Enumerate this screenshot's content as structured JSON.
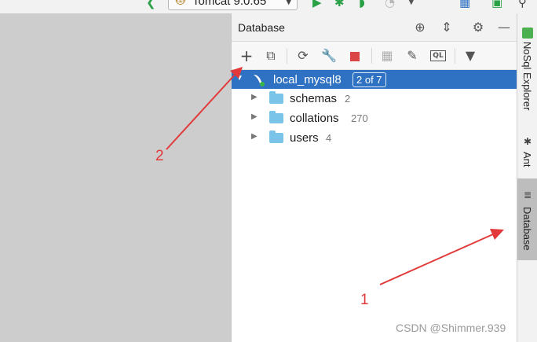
{
  "top_toolbar": {
    "run_config_label": "Tomcat 9.0.65",
    "icons": [
      "back-icon",
      "run-icon",
      "debug-icon",
      "coverage-icon",
      "profile-icon",
      "build-icon",
      "run-window-icon"
    ]
  },
  "database_panel": {
    "title": "Database",
    "header_icons": [
      "crosshair-icon",
      "collapse-icon",
      "gear-icon",
      "minimize-icon"
    ],
    "toolbar_icons": [
      "add-icon",
      "copy-icon",
      "refresh-icon",
      "properties-icon",
      "stop-icon",
      "table-icon",
      "edit-icon",
      "console-icon",
      "filter-icon"
    ],
    "tree": {
      "root": {
        "name": "local_mysql8",
        "badge": "2 of 7",
        "selected": true,
        "expanded": true
      },
      "children": [
        {
          "name": "schemas",
          "count": "2"
        },
        {
          "name": "collations",
          "count": "270"
        },
        {
          "name": "users",
          "count": "4"
        }
      ]
    }
  },
  "right_sidebar": {
    "tabs": [
      {
        "label": "NoSql Explorer",
        "icon": "nosql-icon",
        "active": false
      },
      {
        "label": "Ant",
        "icon": "ant-icon",
        "active": false
      },
      {
        "label": "Database",
        "icon": "database-icon",
        "active": true
      }
    ]
  },
  "annotations": {
    "label_1": "1",
    "label_2": "2",
    "color": "#e23a3a"
  },
  "watermark": "CSDN @Shimmer.939",
  "colors": {
    "selection": "#2f72c4",
    "folder": "#7ac4ea",
    "run_green": "#2aa147",
    "stop_red": "#d94545"
  }
}
